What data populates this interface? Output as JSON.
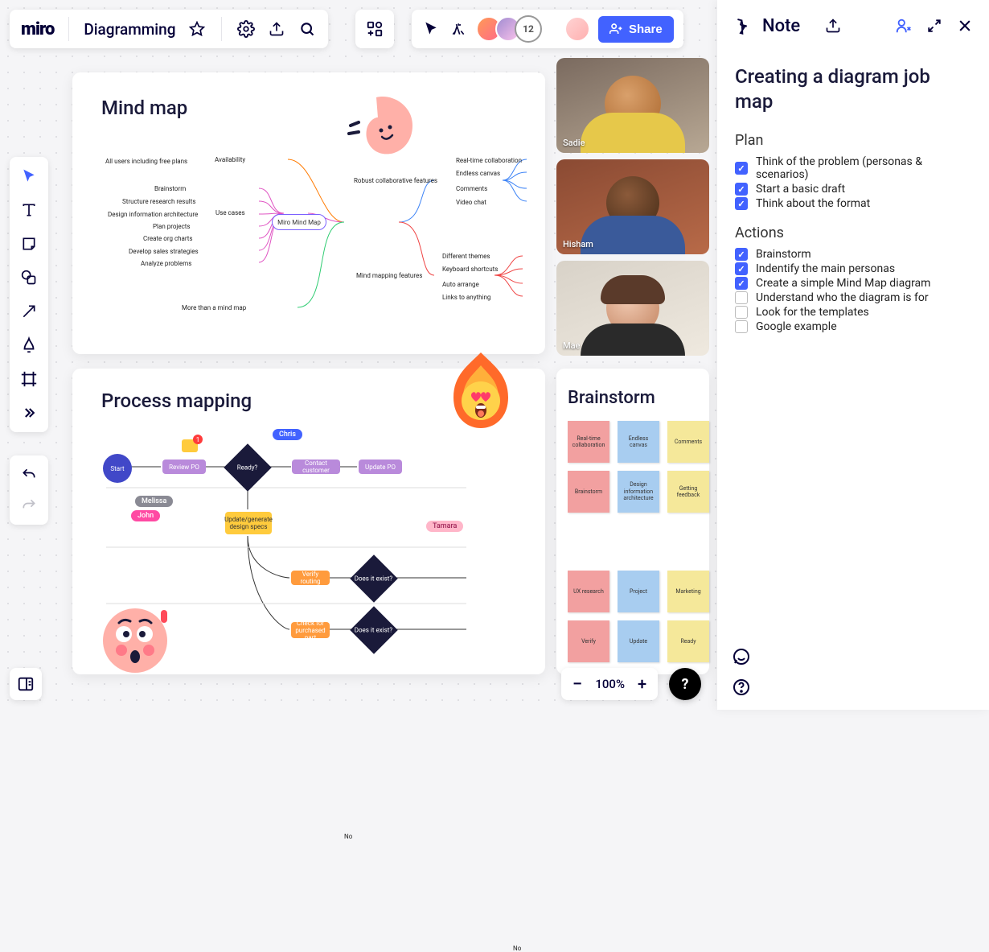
{
  "header": {
    "logo_text": "miro",
    "board_title": "Diagramming",
    "share_label": "Share",
    "participant_count": "12"
  },
  "videos": [
    {
      "name": "Sadie"
    },
    {
      "name": "Hisham"
    },
    {
      "name": "Mae"
    }
  ],
  "mindmap": {
    "title": "Mind map",
    "center": "Miro Mind Map",
    "left_top": "All users including free plans",
    "left_top_right": "Availability",
    "left_mid_label": "Use cases",
    "left_mid": [
      "Brainstorm",
      "Structure research results",
      "Design information architecture",
      "Plan projects",
      "Create org charts",
      "Develop sales strategies",
      "Analyze problems"
    ],
    "left_bottom": "More than a mind map",
    "right_top_label": "Robust collaborative features",
    "right_top": [
      "Real-time collaboration",
      "Endless canvas",
      "Comments",
      "Video chat"
    ],
    "right_bottom_label": "Mind mapping features",
    "right_bottom": [
      "Different themes",
      "Keyboard shortcuts",
      "Auto arrange",
      "Links to anything"
    ]
  },
  "process": {
    "title": "Process mapping",
    "nodes": {
      "start": "Start",
      "review": "Review PO",
      "ready": "Ready?",
      "contact": "Contact customer",
      "update": "Update PO",
      "generate": "Update/generate design specs",
      "verify": "Verify routing",
      "exist1": "Does it exist?",
      "check": "Check for purchased part",
      "exist2": "Does it exist?"
    },
    "labels": {
      "no1": "No",
      "no2": "No"
    },
    "cursors": {
      "chris": "Chris",
      "melissa": "Melissa",
      "john": "John",
      "tamara": "Tamara"
    },
    "comment_badge": "1"
  },
  "brainstorm": {
    "title": "Brainstorm",
    "stickies": [
      {
        "text": "Real-time collaboration",
        "color": "#f2a0a0"
      },
      {
        "text": "Endless canvas",
        "color": "#a8cdf0"
      },
      {
        "text": "Comments",
        "color": "#f5e89a"
      },
      {
        "text": "Brainstorm",
        "color": "#f2a0a0"
      },
      {
        "text": "Design information architecture",
        "color": "#a8cdf0"
      },
      {
        "text": "Getting feedback",
        "color": "#f5e89a"
      },
      {
        "text": "UX research",
        "color": "#f2a0a0"
      },
      {
        "text": "Project",
        "color": "#a8cdf0"
      },
      {
        "text": "Marketing",
        "color": "#f5e89a"
      },
      {
        "text": "Verify",
        "color": "#f2a0a0"
      },
      {
        "text": "Update",
        "color": "#a8cdf0"
      },
      {
        "text": "Ready",
        "color": "#f5e89a"
      }
    ]
  },
  "note_panel": {
    "tab": "Note",
    "heading": "Creating a diagram job map",
    "section1": "Plan",
    "plan": [
      {
        "label": "Think of the problem (personas & scenarios)",
        "checked": true
      },
      {
        "label": "Start a basic draft",
        "checked": true
      },
      {
        "label": "Think about the format",
        "checked": true
      }
    ],
    "section2": "Actions",
    "actions": [
      {
        "label": "Brainstorm",
        "checked": true
      },
      {
        "label": "Indentify the main personas",
        "checked": true
      },
      {
        "label": "Create a simple Mind Map diagram",
        "checked": true
      },
      {
        "label": "Understand who the diagram is for",
        "checked": false
      },
      {
        "label": "Look for the templates",
        "checked": false
      },
      {
        "label": "Google example",
        "checked": false
      }
    ]
  },
  "zoom": {
    "level": "100%"
  },
  "colors": {
    "accent": "#4262ff"
  }
}
